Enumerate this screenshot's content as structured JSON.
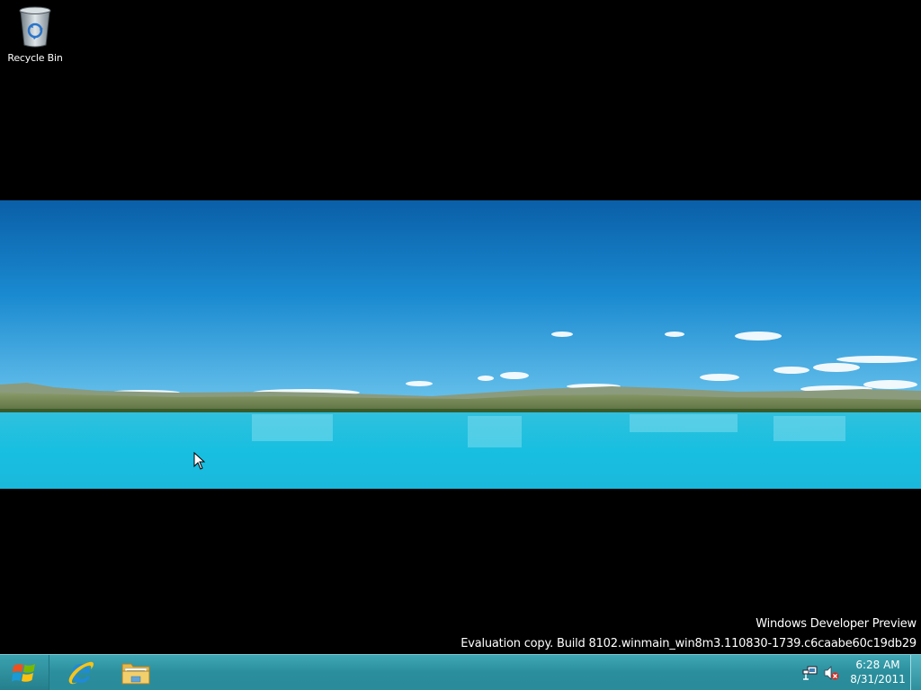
{
  "desktop": {
    "icons": [
      {
        "label": "Recycle Bin",
        "icon": "recycle-bin-icon"
      }
    ]
  },
  "watermark": {
    "line1": "Windows Developer Preview",
    "line2": "Evaluation copy. Build 8102.winmain_win8m3.110830-1739.c6caabe60c19db29"
  },
  "taskbar": {
    "start_icon": "windows-logo-icon",
    "pinned": [
      {
        "name": "internet-explorer",
        "icon": "internet-explorer-icon"
      },
      {
        "name": "windows-explorer",
        "icon": "folder-icon"
      }
    ],
    "tray": {
      "icons": [
        "network-icon",
        "volume-muted-icon"
      ],
      "time": "6:28 AM",
      "date": "8/31/2011"
    }
  },
  "colors": {
    "taskbar": "#2b8e9c",
    "background": "#000000"
  }
}
